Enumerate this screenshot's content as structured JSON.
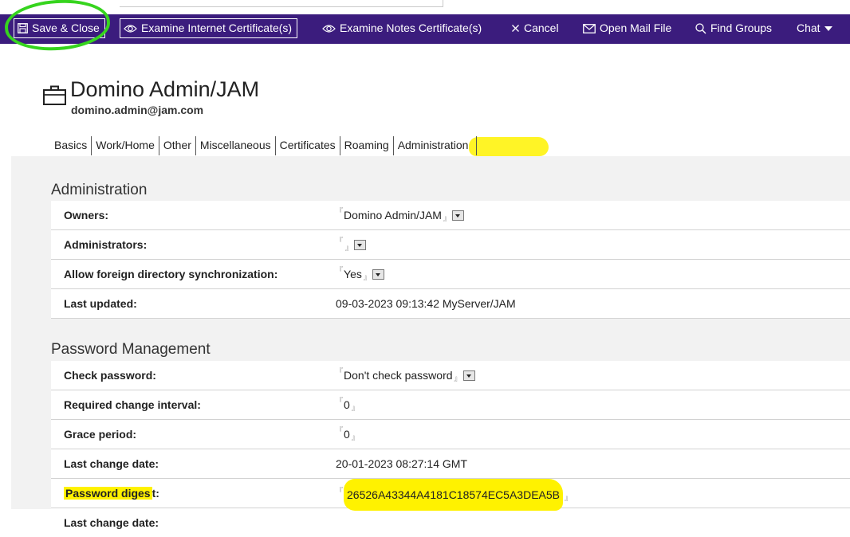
{
  "toolbar": {
    "save_close": "Save & Close",
    "examine_internet": "Examine Internet Certificate(s)",
    "examine_notes": "Examine Notes Certificate(s)",
    "cancel": "Cancel",
    "open_mail": "Open Mail File",
    "find_groups": "Find Groups",
    "chat": "Chat",
    "bar_color": "#3b1c7d"
  },
  "person": {
    "name": "Domino Admin/JAM",
    "email": "domino.admin@jam.com",
    "icon": "briefcase-icon"
  },
  "tabs": [
    "Basics",
    "Work/Home",
    "Other",
    "Miscellaneous",
    "Certificates",
    "Roaming",
    "Administration"
  ],
  "administration": {
    "title": "Administration",
    "rows": [
      {
        "label": "Owners:",
        "value": "Domino Admin/JAM"
      },
      {
        "label": "Administrators:",
        "value": ""
      },
      {
        "label": "Allow foreign directory synchronization:",
        "value": "Yes"
      },
      {
        "label": "Last updated:",
        "value": "09-03-2023 09:13:42 MyServer/JAM"
      }
    ]
  },
  "password": {
    "title": "Password Management",
    "rows": [
      {
        "label": "Check password:",
        "value": "Don't check password"
      },
      {
        "label": "Required change interval:",
        "value": "0"
      },
      {
        "label": "Grace period:",
        "value": "0"
      },
      {
        "label": "Last change date:",
        "value": "20-01-2023 08:27:14 GMT"
      },
      {
        "label_hl": "Password diges",
        "label_rest": "t:",
        "value": "26526A43344A4181C18574EC5A3DEA5B"
      },
      {
        "label": "Last change date:"
      }
    ]
  },
  "highlight_color": "#fff200",
  "annotation_color": "#36d41e"
}
